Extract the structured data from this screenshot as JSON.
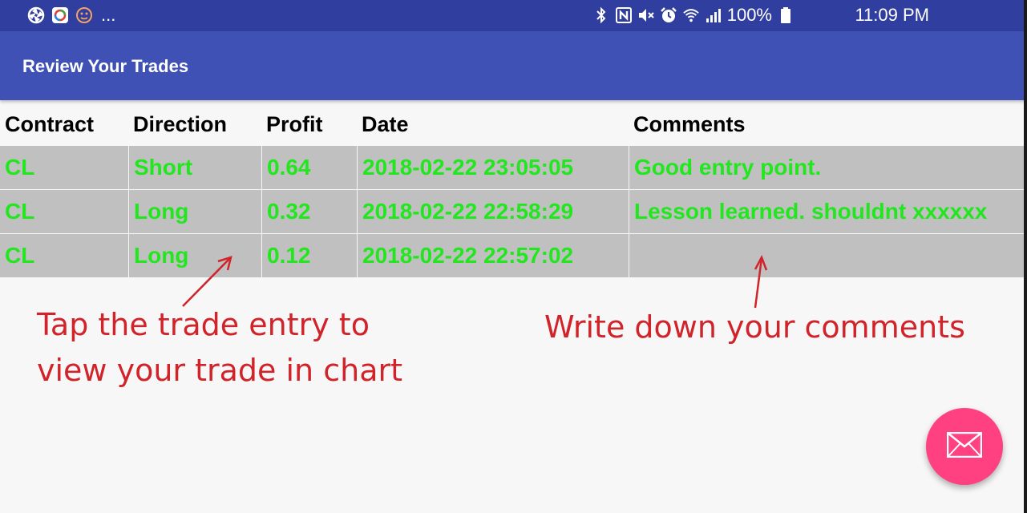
{
  "status_bar": {
    "left_icons": [
      "aperture-icon",
      "photos-app-icon",
      "emoji-icon"
    ],
    "ellipsis": "...",
    "right_icons": [
      "bluetooth-icon",
      "nfc-icon",
      "mute-icon",
      "alarm-icon",
      "wifi-icon",
      "signal-icon",
      "battery-icon"
    ],
    "battery": "100%",
    "time": "11:09 PM"
  },
  "app_bar": {
    "title": "Review Your Trades"
  },
  "table": {
    "headers": [
      "Contract",
      "Direction",
      "Profit",
      "Date",
      "Comments"
    ],
    "rows": [
      [
        "CL",
        "Short",
        "0.64",
        "2018-02-22 23:05:05",
        "Good entry point."
      ],
      [
        "CL",
        "Long",
        "0.32",
        "2018-02-22 22:58:29",
        "Lesson learned. shouldnt xxxxxx"
      ],
      [
        "CL",
        "Long",
        "0.12",
        "2018-02-22 22:57:02",
        ""
      ]
    ]
  },
  "annotations": {
    "left_line1": "Tap the trade entry to",
    "left_line2": "view your trade in chart",
    "right": "Write down your comments"
  },
  "fab": {
    "icon": "mail-icon"
  },
  "colors": {
    "status_bar": "#303f9f",
    "app_bar": "#3f51b5",
    "row_bg": "#c0c0c0",
    "row_text": "#22e61e",
    "annotation": "#d1232a",
    "fab": "#ff4081"
  }
}
